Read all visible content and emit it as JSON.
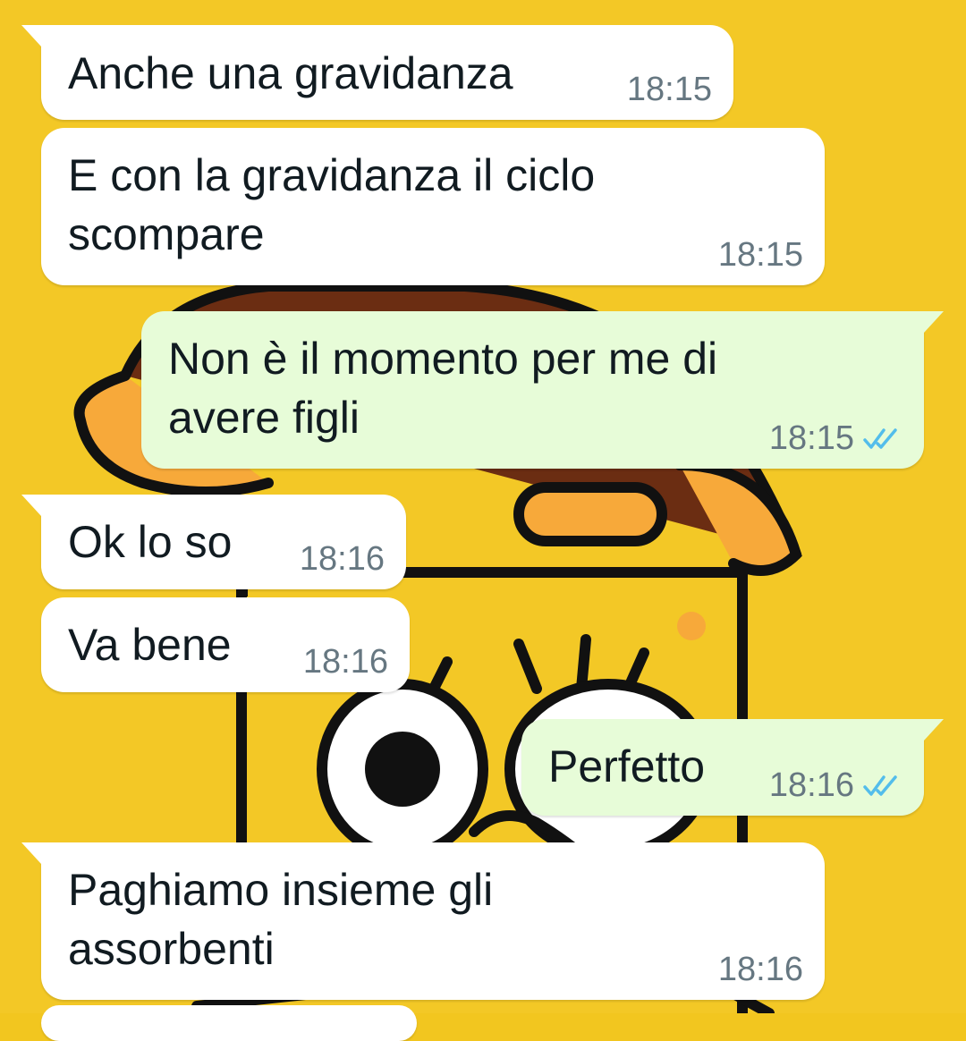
{
  "colors": {
    "wallpaper": "#f2c61f",
    "incoming_bubble": "#ffffff",
    "outgoing_bubble": "#e7fcd8",
    "timestamp": "#667781",
    "read_ticks": "#53bdeb"
  },
  "messages": [
    {
      "direction": "incoming",
      "text": "Anche una gravidanza",
      "time": "18:15"
    },
    {
      "direction": "incoming",
      "text": "E con la gravidanza il ciclo\nscompare",
      "time": "18:15"
    },
    {
      "direction": "outgoing",
      "text": "Non è il momento per me di\navere figli",
      "time": "18:15",
      "status_icon": "double-check-read-icon"
    },
    {
      "direction": "incoming",
      "text": "Ok lo so",
      "time": "18:16"
    },
    {
      "direction": "incoming",
      "text": "Va bene",
      "time": "18:16"
    },
    {
      "direction": "outgoing",
      "text": "Perfetto",
      "time": "18:16",
      "status_icon": "double-check-read-icon"
    },
    {
      "direction": "incoming",
      "text": "Paghiamo insieme gli\nassorbenti",
      "time": "18:16"
    }
  ]
}
